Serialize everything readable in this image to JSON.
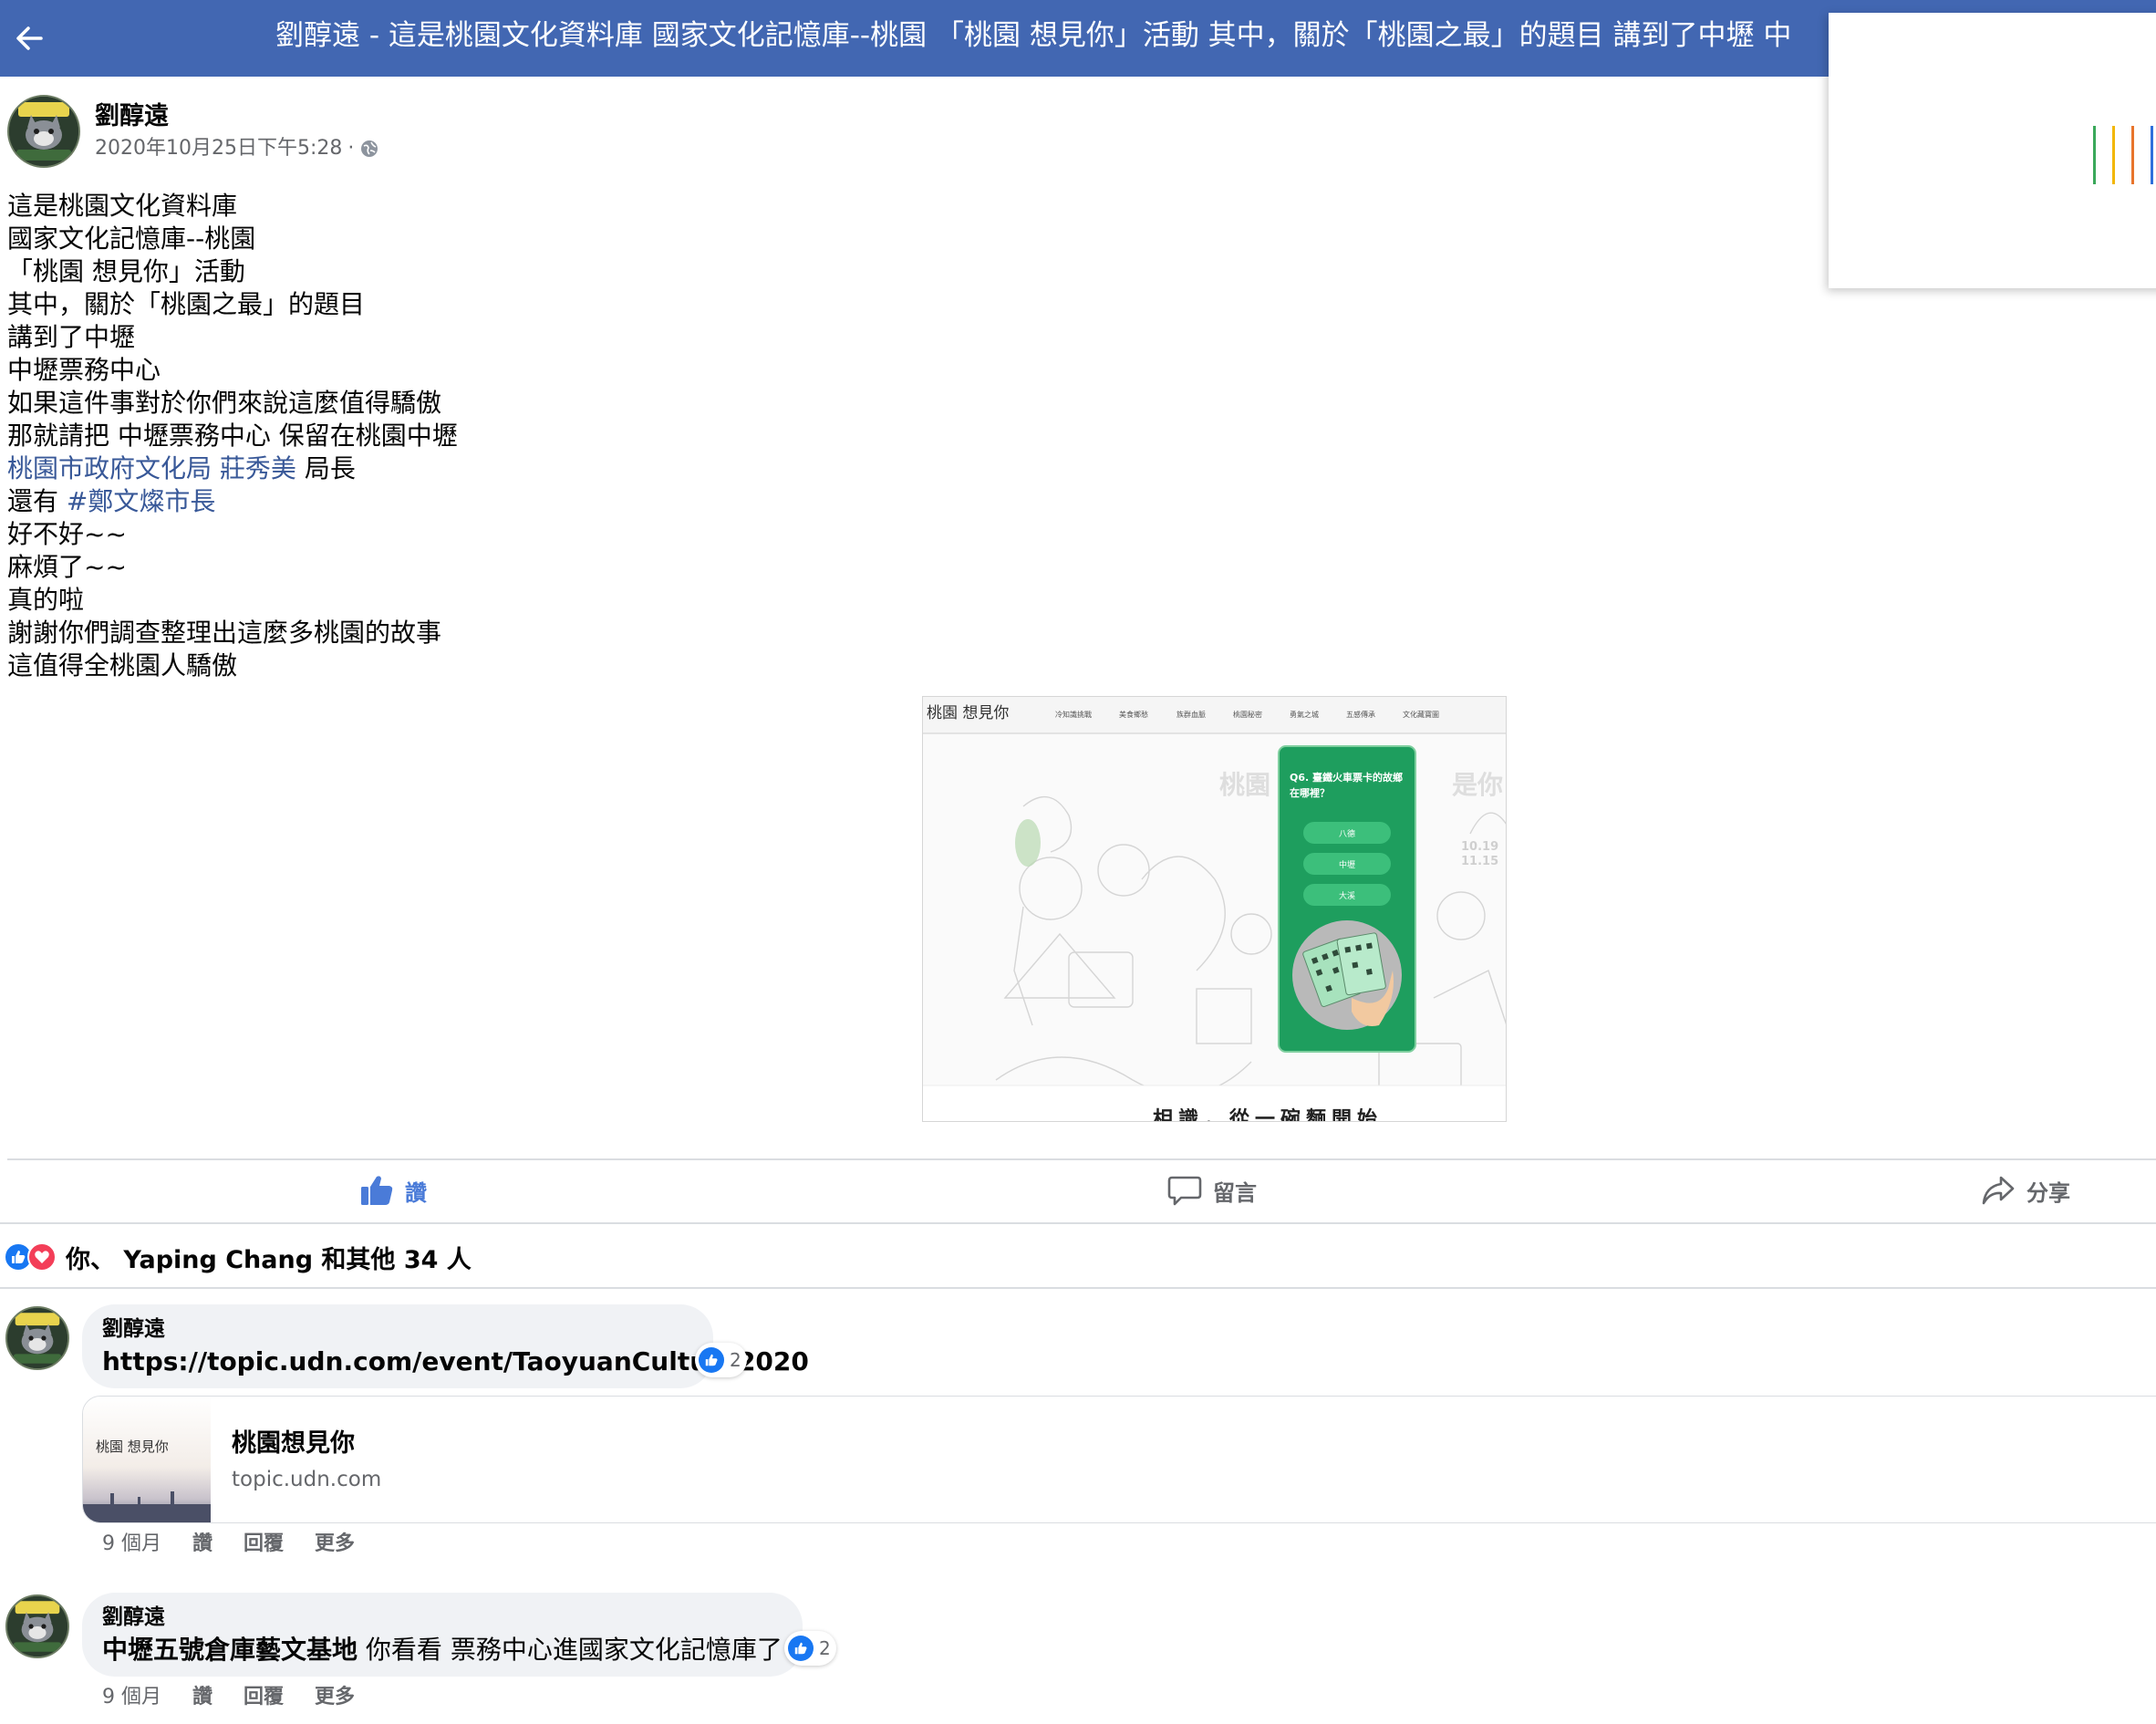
{
  "header": {
    "back_icon": "arrow-left-icon",
    "title": "劉醇遠 - 這是桃園文化資料庫 國家文化記憶庫--桃園 「桃園 想見你」活動 其中，關於「桃園之最」的題目 講到了中壢 中"
  },
  "post": {
    "author": "劉醇遠",
    "timestamp": "2020年10月25日下午5:28",
    "separator": "·",
    "privacy_icon": "globe-icon",
    "lines": [
      "這是桃園文化資料庫",
      "國家文化記憶庫--桃園",
      "「桃園 想見你」活動",
      "其中，關於「桃園之最」的題目",
      "講到了中壢",
      "中壢票務中心",
      "如果這件事對於你們來說這麼值得驕傲",
      "那就請把 中壢票務中心 保留在桃園中壢"
    ],
    "mention_line": {
      "mention1": "桃園市政府文化局",
      "mention2": "莊秀美",
      "suffix": " 局長"
    },
    "hashtag_line": {
      "prefix": "還有 ",
      "hashtag": "#鄭文燦市長"
    },
    "lines_after": [
      "好不好~~",
      "麻煩了~~",
      "真的啦",
      "謝謝你們調查整理出這麼多桃園的故事",
      "這值得全桃園人驕傲"
    ]
  },
  "post_image": {
    "logo": "桃園 想見你",
    "nav_items": [
      "冷知識挑戰",
      "美食鄉愁",
      "族群血脈",
      "桃園秘密",
      "勇氣之城",
      "五感傳承",
      "文化藏寶圖"
    ],
    "bg_text_left": "桃園",
    "bg_text_right": "是你",
    "dates": [
      "10.19",
      "11.15"
    ],
    "quiz_question_line1": "Q6. 臺鐵火車票卡的故鄉",
    "quiz_question_line2": "在哪裡？",
    "options": [
      "八德",
      "中壢",
      "大溪"
    ],
    "bottom_caption": "相識，從一碗麵開始"
  },
  "actions": {
    "like": "讚",
    "comment": "留言",
    "share": "分享",
    "like_icon": "thumbs-up-icon",
    "comment_icon": "comment-bubble-icon",
    "share_icon": "share-arrow-icon"
  },
  "reactions": {
    "summary": "你、 Yaping Chang 和其他 34 人",
    "icons": [
      "like-reaction-icon",
      "love-reaction-icon"
    ]
  },
  "comments": [
    {
      "author": "劉醇遠",
      "link_text": "https://topic.udn.com/event/TaoyuanCulture2020",
      "like_count": "2",
      "preview": {
        "thumb_text": "桃園 想見你",
        "title": "桃園想見你",
        "domain": "topic.udn.com"
      },
      "time": "9 個月",
      "like_label": "讚",
      "reply_label": "回覆",
      "more_label": "更多"
    },
    {
      "author": "劉醇遠",
      "bold_text": "中壢五號倉庫藝文基地",
      "text": " 你看看 票務中心進國家文化記憶庫了",
      "like_count": "2",
      "time": "9 個月",
      "like_label": "讚",
      "reply_label": "回覆",
      "more_label": "更多"
    }
  ],
  "colors": {
    "header_bg": "#4267b2",
    "link": "#385898",
    "like_active": "#4a7bd8",
    "quiz_green": "#1e9e5e",
    "bubble_bg": "#f0f2f5"
  }
}
